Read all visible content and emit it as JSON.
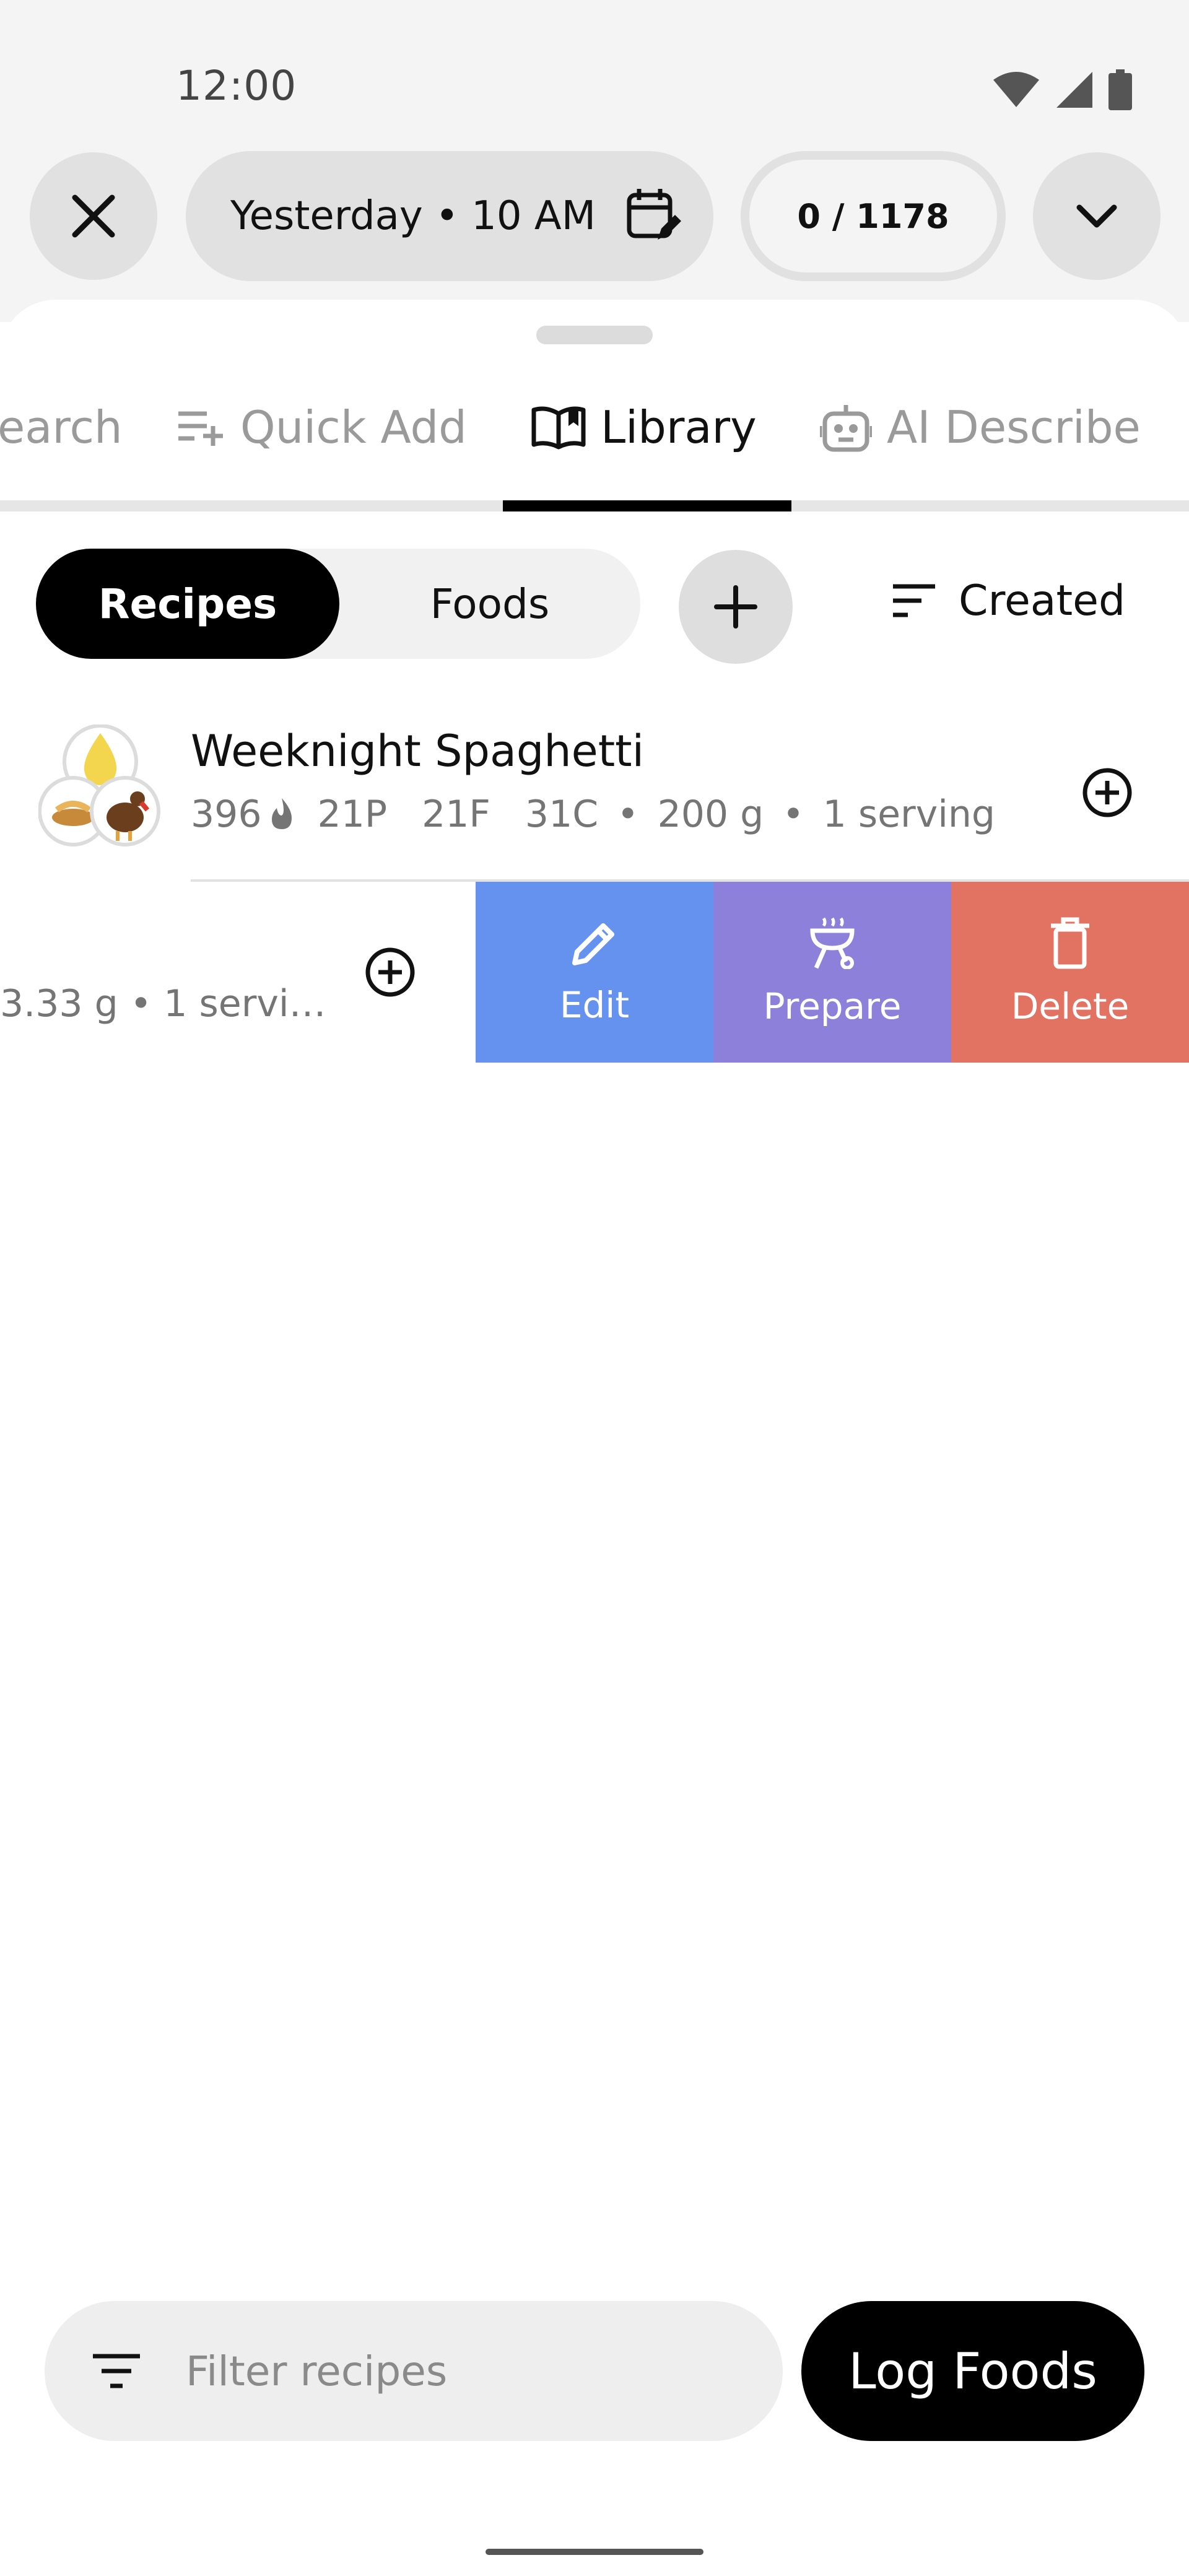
{
  "status_bar": {
    "time": "12:00"
  },
  "header": {
    "date_label": "Yesterday • 10 AM",
    "calorie_count": "0 / 1178"
  },
  "tabs": [
    {
      "label": "Search",
      "visible_label": "earch",
      "icon": "search-icon",
      "active": false
    },
    {
      "label": "Quick Add",
      "icon": "playlist-add-icon",
      "active": false
    },
    {
      "label": "Library",
      "icon": "open-book-icon",
      "active": true
    },
    {
      "label": "AI Describe",
      "icon": "robot-icon",
      "active": false
    }
  ],
  "segmented": {
    "recipes": "Recipes",
    "foods": "Foods",
    "selected": "Recipes"
  },
  "sort": {
    "label": "Created"
  },
  "recipes": [
    {
      "title": "Weeknight Spaghetti",
      "calories": "396",
      "protein": "21P",
      "fat": "21F",
      "carbs": "31C",
      "weight": "200 g",
      "servings": "1 serving",
      "avatar_icons": [
        "oil-drop-icon",
        "pasta-icon",
        "turkey-icon"
      ]
    }
  ],
  "swiped_row": {
    "meta": "3.33 g  •  1 servi…",
    "actions": [
      {
        "label": "Edit",
        "icon": "pencil-icon",
        "color": "#6592ef"
      },
      {
        "label": "Prepare",
        "icon": "grill-icon",
        "color": "#8c80da"
      },
      {
        "label": "Delete",
        "icon": "trash-icon",
        "color": "#e27262"
      }
    ]
  },
  "bottom": {
    "filter_placeholder": "Filter recipes",
    "log_button": "Log Foods"
  }
}
